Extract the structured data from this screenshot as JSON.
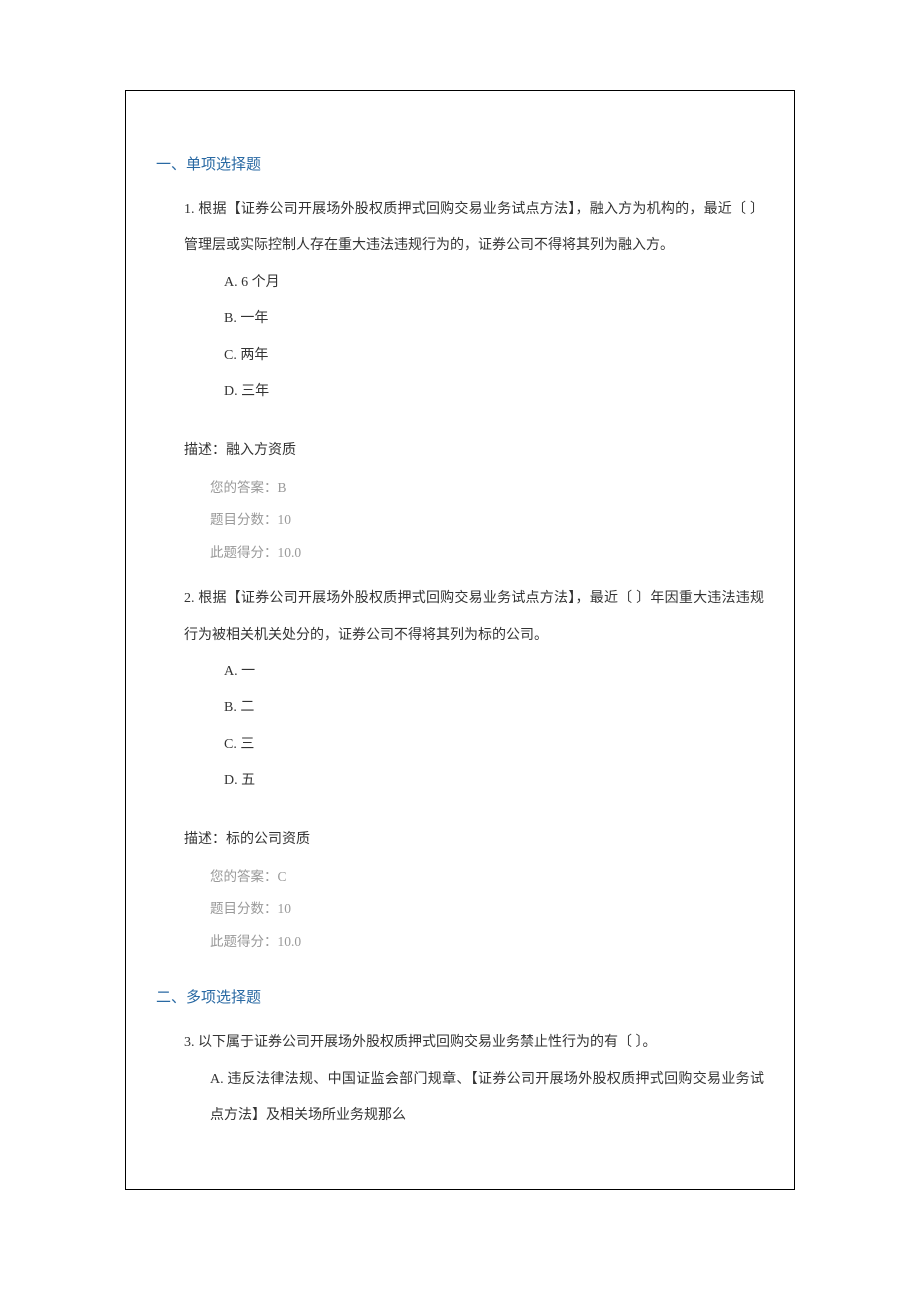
{
  "section1": {
    "title": "一、单项选择题",
    "q1": {
      "text": "1. 根据【证券公司开展场外股权质押式回购交易业务试点方法】，融入方为机构的，最近〔  〕管理层或实际控制人存在重大违法违规行为的，证券公司不得将其列为融入方。",
      "optA": "A. 6 个月",
      "optB": "B. 一年",
      "optC": "C. 两年",
      "optD": "D. 三年",
      "desc": "描述：融入方资质",
      "your_answer": "您的答案：B",
      "score": "题目分数：10",
      "got": "此题得分：10.0"
    },
    "q2": {
      "text": "2. 根据【证券公司开展场外股权质押式回购交易业务试点方法】，最近〔  〕年因重大违法违规行为被相关机关处分的，证券公司不得将其列为标的公司。",
      "optA": "A. 一",
      "optB": "B. 二",
      "optC": "C. 三",
      "optD": "D. 五",
      "desc": "描述：标的公司资质",
      "your_answer": "您的答案：C",
      "score": "题目分数：10",
      "got": "此题得分：10.0"
    }
  },
  "section2": {
    "title": "二、多项选择题",
    "q3": {
      "text": "3. 以下属于证券公司开展场外股权质押式回购交易业务禁止性行为的有〔  〕。",
      "optA": "A. 违反法律法规、中国证监会部门规章、【证券公司开展场外股权质押式回购交易业务试点方法】及相关场所业务规那么"
    }
  },
  "footer": ""
}
